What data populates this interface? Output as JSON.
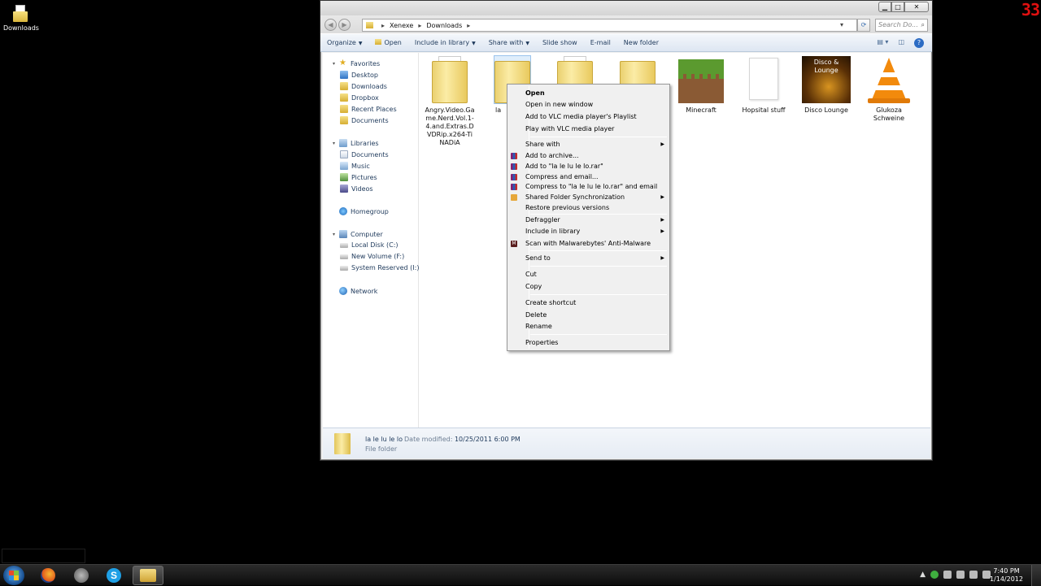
{
  "desktop": {
    "icon_label": "Downloads",
    "overlay_counter": "33"
  },
  "window": {
    "address": {
      "crumbs": [
        "Xenexe",
        "Downloads"
      ],
      "search_placeholder": "Search Do..."
    },
    "toolbar": {
      "organize": "Organize",
      "open": "Open",
      "include_in_library": "Include in library",
      "share_with": "Share with",
      "slide_show": "Slide show",
      "email": "E-mail",
      "new_folder": "New folder"
    },
    "nav": {
      "favorites": "Favorites",
      "favorites_items": [
        "Desktop",
        "Downloads",
        "Dropbox",
        "Recent Places",
        "Documents"
      ],
      "libraries": "Libraries",
      "libraries_items": [
        "Documents",
        "Music",
        "Pictures",
        "Videos"
      ],
      "homegroup": "Homegroup",
      "computer": "Computer",
      "computer_items": [
        "Local Disk (C:)",
        "New Volume (F:)",
        "System Reserved (I:)"
      ],
      "network": "Network"
    },
    "files": [
      {
        "label": "Angry.Video.Game.Nerd.Vol.1-4.and.Extras.DVDRip.x264-TiNADiA"
      },
      {
        "label": "la"
      },
      {
        "label": ""
      },
      {
        "label": ""
      },
      {
        "label": "Minecraft"
      },
      {
        "label": "Hopsital stuff"
      },
      {
        "label": "Disco Lounge",
        "thumb_text": "Disco & Lounge"
      },
      {
        "label": "Glukoza Schweine"
      }
    ],
    "status": {
      "name": "la le lu le lo",
      "date_label": "Date modified:",
      "date_value": "10/25/2011 6:00 PM",
      "type": "File folder"
    }
  },
  "context_menu": {
    "items": {
      "open": "Open",
      "open_new_window": "Open in new window",
      "vlc_add": "Add to VLC media player's Playlist",
      "vlc_play": "Play with VLC media player",
      "share_with": "Share with",
      "add_archive": "Add to archive...",
      "add_rar": "Add to \"la le lu le lo.rar\"",
      "compress_email": "Compress and email...",
      "compress_rar_email": "Compress to \"la le lu le lo.rar\" and email",
      "shared_sync": "Shared Folder Synchronization",
      "restore": "Restore previous versions",
      "defraggler": "Defraggler",
      "include_library": "Include in library",
      "malwarebytes": "Scan with Malwarebytes' Anti-Malware",
      "send_to": "Send to",
      "cut": "Cut",
      "copy": "Copy",
      "create_shortcut": "Create shortcut",
      "delete": "Delete",
      "rename": "Rename",
      "properties": "Properties"
    }
  },
  "taskbar": {
    "time": "7:40 PM",
    "date": "1/14/2012"
  }
}
